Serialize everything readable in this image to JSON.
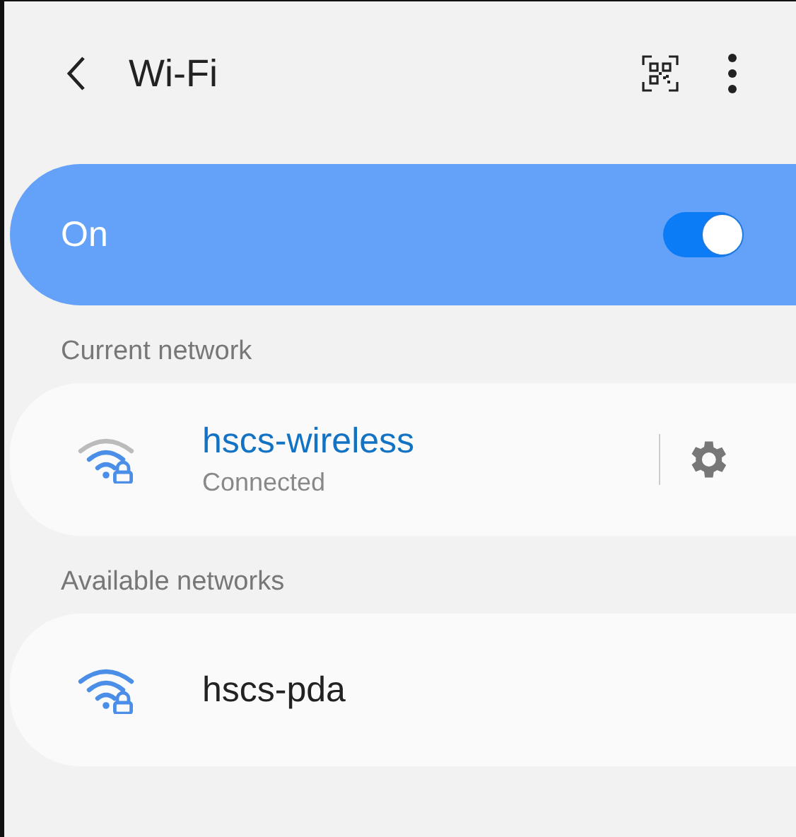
{
  "header": {
    "title": "Wi-Fi"
  },
  "master_switch": {
    "label": "On",
    "on": true
  },
  "sections": [
    {
      "title": "Current network",
      "networks": [
        {
          "name": "hscs-wireless",
          "status": "Connected",
          "connected": true
        }
      ]
    },
    {
      "title": "Available networks",
      "networks": [
        {
          "name": "hscs-pda",
          "connected": false
        }
      ]
    }
  ]
}
